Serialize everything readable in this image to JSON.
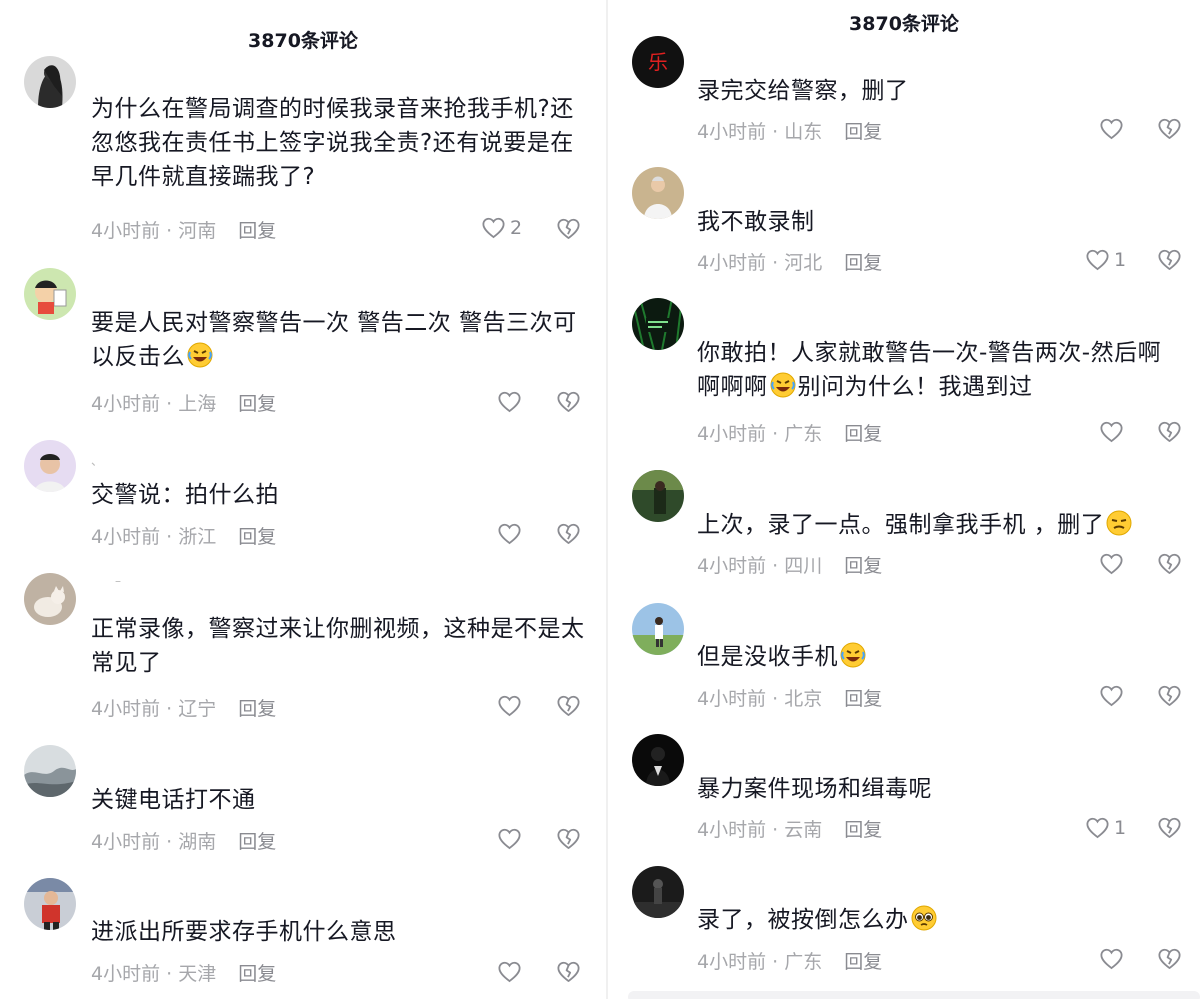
{
  "left_panel": {
    "title": "3870条评论",
    "comments": [
      {
        "text": "为什么在警局调查的时候我录音来抢我手机?还忽悠我在责任书上签字说我全责?还有说要是在早几件就直接踹我了?",
        "time": "4小时前",
        "location": "河南",
        "reply": "回复",
        "likes": "2",
        "avatar": "dark-figure-avatar"
      },
      {
        "text_before": "要是人民对警察警告一次 警告二次 警告三次可以反击么",
        "text_after": "",
        "emoji": "rofl-emoji",
        "time": "4小时前",
        "location": "上海",
        "reply": "回复",
        "likes": "",
        "avatar": "cartoon-avatar"
      },
      {
        "text": "交警说：拍什么拍",
        "time": "4小时前",
        "location": "浙江",
        "reply": "回复",
        "likes": "",
        "avatar": "person-avatar",
        "name_hint": "、"
      },
      {
        "text": "正常录像，警察过来让你删视频，这种是不是太常见了",
        "time": "4小时前",
        "location": "辽宁",
        "reply": "回复",
        "likes": "",
        "avatar": "cat-avatar",
        "name_hint": "–"
      },
      {
        "text": "关键电话打不通",
        "time": "4小时前",
        "location": "湖南",
        "reply": "回复",
        "likes": "",
        "avatar": "misty-avatar"
      },
      {
        "text": "进派出所要求存手机什么意思",
        "time": "4小时前",
        "location": "天津",
        "reply": "回复",
        "likes": "",
        "avatar": "child-avatar"
      }
    ]
  },
  "right_panel": {
    "title": "3870条评论",
    "comments": [
      {
        "text": "录完交给警察，删了",
        "time": "4小时前",
        "location": "山东",
        "reply": "回复",
        "likes": "",
        "avatar": "le-avatar",
        "avatar_text": "乐"
      },
      {
        "text": "我不敢录制",
        "time": "4小时前",
        "location": "河北",
        "reply": "回复",
        "likes": "1",
        "avatar": "elder-avatar"
      },
      {
        "text_before": "你敢拍！人家就敢警告一次-警告两次-然后啊啊啊啊",
        "text_after": "别问为什么！我遇到过",
        "emoji": "rofl-emoji",
        "time": "4小时前",
        "location": "广东",
        "reply": "回复",
        "likes": "",
        "avatar": "green-dream-avatar"
      },
      {
        "text_before": "上次，录了一点。强制拿我手机 ，删了",
        "text_after": "",
        "emoji": "smirk-emoji",
        "time": "4小时前",
        "location": "四川",
        "reply": "回复",
        "likes": "",
        "avatar": "green-scene-avatar"
      },
      {
        "text_before": "但是没收手机",
        "text_after": "",
        "emoji": "rofl-emoji",
        "time": "4小时前",
        "location": "北京",
        "reply": "回复",
        "likes": "",
        "avatar": "outdoor-avatar"
      },
      {
        "text": "暴力案件现场和缉毒呢",
        "time": "4小时前",
        "location": "云南",
        "reply": "回复",
        "likes": "1",
        "avatar": "suit-avatar"
      },
      {
        "text_before": "录了，被按倒怎么办",
        "text_after": "",
        "emoji": "pleading-emoji",
        "time": "4小时前",
        "location": "广东",
        "reply": "回复",
        "likes": "",
        "avatar": "dark-street-avatar"
      }
    ]
  },
  "colors": {
    "text": "#161823",
    "meta": "#a6a7ab",
    "icon": "#8a8b91"
  }
}
